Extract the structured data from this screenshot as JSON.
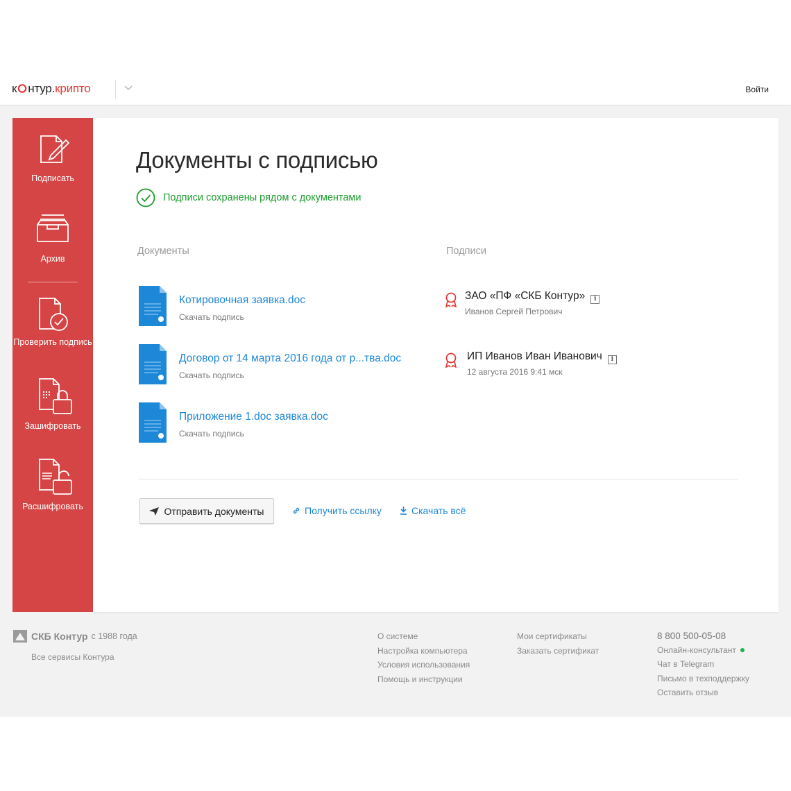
{
  "header": {
    "logo_k": "к",
    "logo_ntur": "нтур.",
    "logo_crypto": "крипто",
    "login": "Войти"
  },
  "sidebar": {
    "items": [
      {
        "label": "Подписать"
      },
      {
        "label": "Архив"
      },
      {
        "label": "Проверить подпись"
      },
      {
        "label": "Зашифровать"
      },
      {
        "label": "Расшифровать"
      }
    ]
  },
  "main": {
    "title": "Документы с подписью",
    "status": "Подписи сохранены рядом с документами",
    "documents_header": "Документы",
    "signatures_header": "Подписи",
    "documents": [
      {
        "name": "Котировочная заявка.doc",
        "action": "Скачать подпись"
      },
      {
        "name": "Договор от 14 марта 2016 года от р...тва.doc",
        "action": "Скачать подпись"
      },
      {
        "name": "Приложение 1.doc заявка.doc",
        "action": "Скачать подпись"
      }
    ],
    "signatures": [
      {
        "org": "ЗАО «ПФ «СКБ Контур»",
        "detail": "Иванов Сергей Петрович"
      },
      {
        "org": "ИП Иванов Иван Иванович",
        "detail": "12 августа 2016  9:41 мск"
      }
    ],
    "info_glyph": "i",
    "actions": {
      "send": "Отправить документы",
      "get_link": "Получить ссылку",
      "download_all": "Скачать всё"
    }
  },
  "footer": {
    "brand": "СКБ Контур",
    "since": "с 1988 года",
    "all_services": "Все сервисы Контура",
    "col1": [
      "О системе",
      "Настройка компьютера",
      "Условия использования",
      "Помощь и инструкции"
    ],
    "col2": [
      "Мои сертификаты",
      "Заказать сертификат"
    ],
    "phone": "8 800 500-05-08",
    "col3": [
      "Онлайн-консультант",
      "Чат в Telegram",
      "Письмо в техподдержку",
      "Оставить отзыв"
    ]
  },
  "colors": {
    "accent_red": "#d64545",
    "link_blue": "#1e87d6",
    "success_green": "#1a9c2c",
    "doc_blue": "#1e88d8"
  }
}
